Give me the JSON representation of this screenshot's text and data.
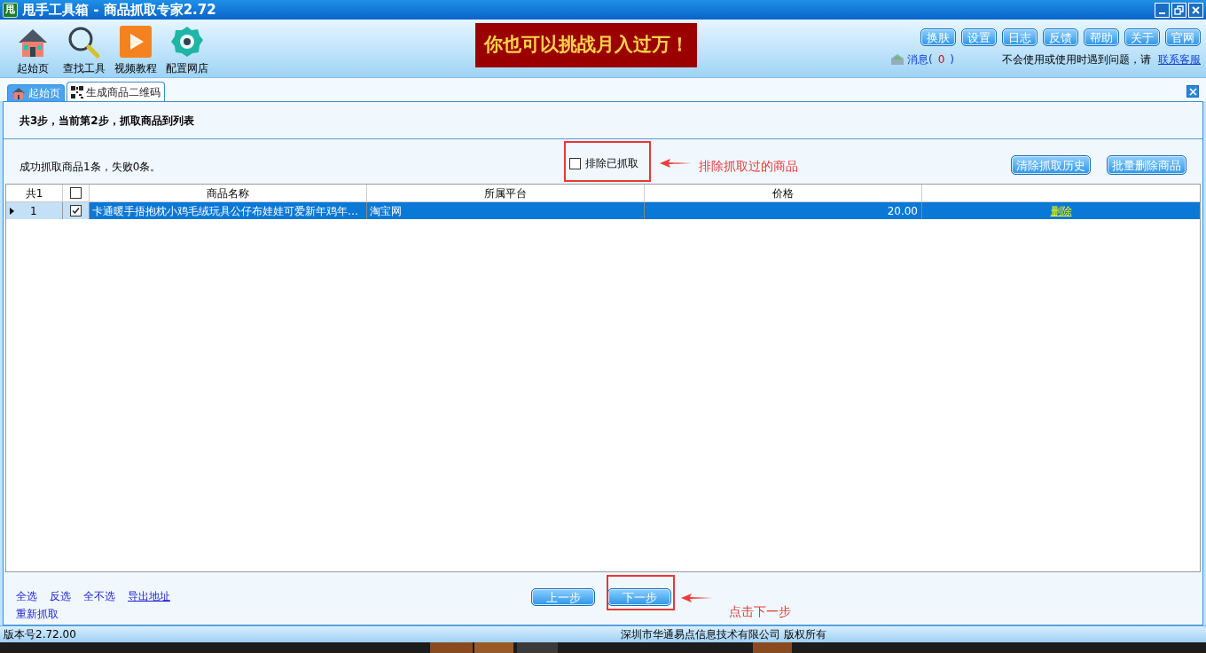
{
  "window": {
    "title": "甩手工具箱 - 商品抓取专家2.72",
    "app_icon": "甩"
  },
  "toolbar": [
    {
      "label": "起始页",
      "kind": "home"
    },
    {
      "label": "查找工具",
      "kind": "search"
    },
    {
      "label": "视频教程",
      "kind": "video"
    },
    {
      "label": "配置网店",
      "kind": "gear"
    }
  ],
  "banner": "你也可以挑战月入过万！",
  "top_buttons": [
    "换肤",
    "设置",
    "日志",
    "反馈",
    "帮助",
    "关于",
    "官网"
  ],
  "messages": {
    "label": "消息(",
    "count": "0",
    "close": ")"
  },
  "help_text": "不会使用或使用时遇到问题，请",
  "help_link": "联系客服",
  "tabs": [
    {
      "label": "起始页",
      "selected": false,
      "kind": "home"
    },
    {
      "label": "生成商品二维码",
      "selected": true,
      "kind": "qr"
    }
  ],
  "step_text": "共3步，当前第2步，抓取商品到列表",
  "result_text": "成功抓取商品1条，失败0条。",
  "exclude": {
    "label": "排除已抓取",
    "checked": false
  },
  "annotations": [
    "排除抓取过的商品",
    "点击下一步"
  ],
  "action_buttons": [
    "清除抓取历史",
    "批量删除商品"
  ],
  "table": {
    "count_header": "共1",
    "all_checked": false,
    "columns": [
      "商品名称",
      "所属平台",
      "价格"
    ],
    "rows": [
      {
        "index": "1",
        "checked": true,
        "selected": true,
        "name": "卡通暖手捂抱枕小鸡毛绒玩具公仔布娃娃可爱新年鸡年…",
        "platform": "淘宝网",
        "price": "20.00",
        "action": "删除"
      }
    ]
  },
  "links": [
    {
      "label": "全选",
      "underline": false
    },
    {
      "label": "反选",
      "underline": false
    },
    {
      "label": "全不选",
      "underline": false
    },
    {
      "label": "导出地址",
      "underline": true
    },
    {
      "label": "重新抓取",
      "underline": false
    }
  ],
  "nav_buttons": [
    "上一步",
    "下一步"
  ],
  "status_bar": {
    "version": "版本号2.72.00",
    "copyright": "深圳市华通易点信息技术有限公司 版权所有"
  }
}
